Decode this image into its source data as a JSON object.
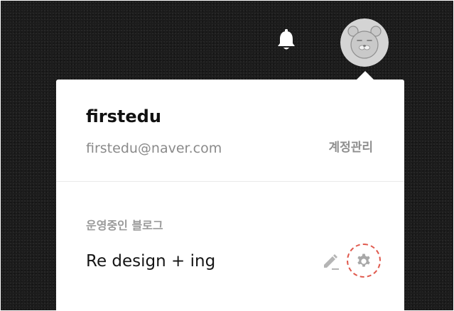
{
  "header": {
    "notification_icon": "bell-icon",
    "avatar_icon": "bear-face-icon"
  },
  "profile_menu": {
    "username": "firstedu",
    "email": "firstedu@naver.com",
    "account_link": "계정관리",
    "blog_section_label": "운영중인 블로그",
    "blog_name": "Re design + ing",
    "edit_icon": "pencil-icon",
    "settings_icon": "gear-icon"
  },
  "colors": {
    "background": "#1c1c1c",
    "panel": "#ffffff",
    "muted_text": "#8a8a8a",
    "icon_gray": "#b5b5b5",
    "highlight": "#e05a4e"
  }
}
